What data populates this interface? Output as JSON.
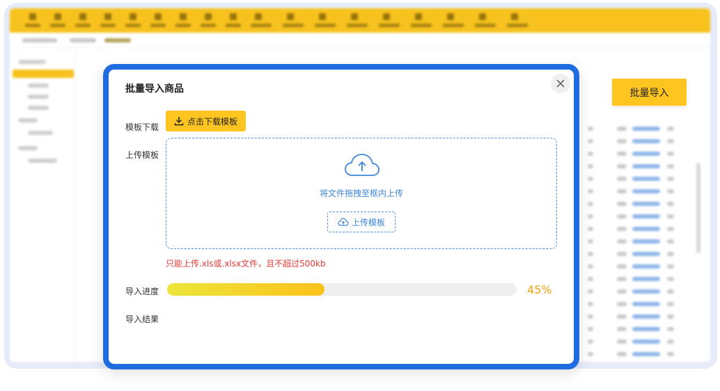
{
  "bulk_button_label": "批量导入",
  "modal": {
    "title": "批量导入商品",
    "template_download_label": "模板下载",
    "download_button": "点击下载模板",
    "upload_template_label": "上传模板",
    "drop_text": "将文件拖拽至框内上传",
    "upload_button": "上传模板",
    "hint": "只能上传.xls或.xlsx文件，且不超过500kb",
    "progress_label": "导入进度",
    "progress_value": 0.45,
    "progress_text": "45%",
    "result_label": "导入结果"
  },
  "colors": {
    "accent_yellow": "#fec520",
    "modal_border": "#1f6be0",
    "link_blue": "#3d86d9",
    "error_red": "#e53935",
    "progress_orange": "#f2a20c"
  },
  "icons": {
    "download": "download-icon",
    "cloud_upload": "cloud-upload-icon",
    "close": "close-icon"
  }
}
